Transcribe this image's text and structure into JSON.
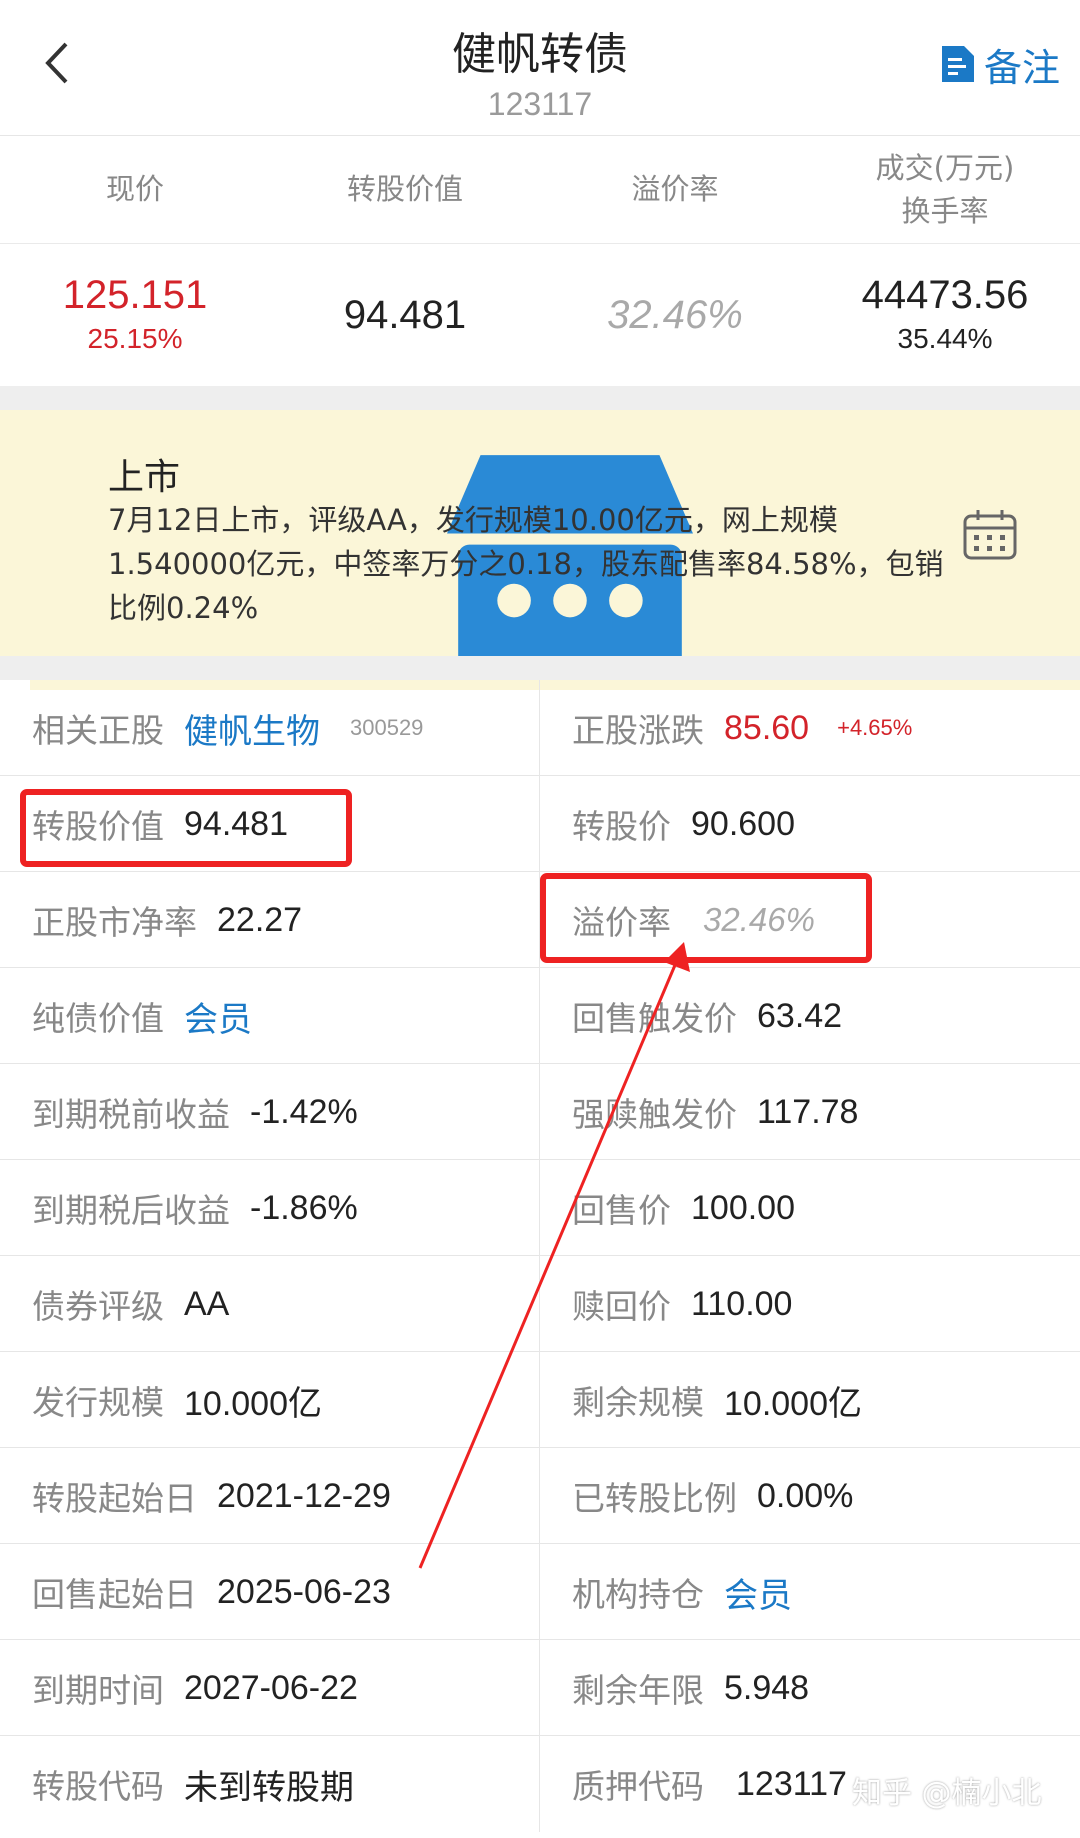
{
  "header": {
    "title": "健帆转债",
    "code": "123117",
    "note_label": "备注"
  },
  "quote": {
    "headers": {
      "price": "现价",
      "conv_value": "转股价值",
      "premium": "溢价率",
      "volume_line1": "成交(万元)",
      "volume_line2": "换手率"
    },
    "price": "125.151",
    "change_pct": "25.15%",
    "conv_value": "94.481",
    "premium": "32.46%",
    "volume": "44473.56",
    "turnover": "35.44%"
  },
  "notice": {
    "title": "上市",
    "text": "7月12日上市，评级AA，发行规模10.00亿元，网上规模1.540000亿元，中签率万分之0.18，股东配售率84.58%，包销比例0.24%"
  },
  "details": {
    "stock_label": "相关正股",
    "stock_name": "健帆生物",
    "stock_code": "300529",
    "stock_change_label": "正股涨跌",
    "stock_price": "85.60",
    "stock_change": "+4.65%",
    "conv_value_label": "转股价值",
    "conv_value": "94.481",
    "conv_price_label": "转股价",
    "conv_price": "90.600",
    "pb_label": "正股市净率",
    "pb": "22.27",
    "premium_label": "溢价率",
    "premium": "32.46%",
    "bond_value_label": "纯债价值",
    "bond_value": "会员",
    "putback_trigger_label": "回售触发价",
    "putback_trigger": "63.42",
    "pretax_yield_label": "到期税前收益",
    "pretax_yield": "-1.42%",
    "redeem_trigger_label": "强赎触发价",
    "redeem_trigger": "117.78",
    "aftertax_yield_label": "到期税后收益",
    "aftertax_yield": "-1.86%",
    "putback_price_label": "回售价",
    "putback_price": "100.00",
    "rating_label": "债券评级",
    "rating": "AA",
    "redeem_price_label": "赎回价",
    "redeem_price": "110.00",
    "issue_size_label": "发行规模",
    "issue_size": "10.000亿",
    "remaining_size_label": "剩余规模",
    "remaining_size": "10.000亿",
    "conv_start_label": "转股起始日",
    "conv_start": "2021-12-29",
    "converted_ratio_label": "已转股比例",
    "converted_ratio": "0.00%",
    "putback_start_label": "回售起始日",
    "putback_start": "2025-06-23",
    "institution_label": "机构持仓",
    "institution": "会员",
    "maturity_label": "到期时间",
    "maturity": "2027-06-22",
    "remaining_years_label": "剩余年限",
    "remaining_years": "5.948",
    "conv_code_label": "转股代码",
    "conv_code": "未到转股期",
    "pledge_code_label": "质押代码",
    "pledge_code": "123117"
  },
  "watermark": "知乎 @楠小北",
  "colors": {
    "accent_blue": "#1b79c6",
    "up_red": "#d3232a",
    "annotation_red": "#ee2222",
    "notice_bg": "#fbf6d8"
  }
}
